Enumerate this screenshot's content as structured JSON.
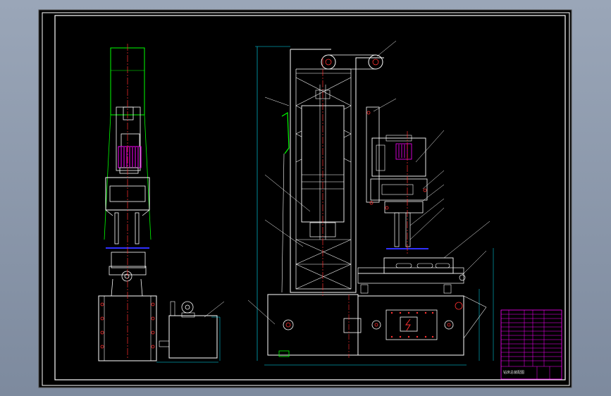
{
  "title_block": {
    "title": "钻床总装配图",
    "rows": [
      "",
      "",
      "",
      "",
      "",
      "",
      "",
      "",
      "",
      "",
      "",
      ""
    ]
  },
  "colors": {
    "background": "#000000",
    "frame": "#ffffff",
    "part_lines": "#ffffff",
    "center_lines": "#ff3030",
    "green_outline": "#00ff00",
    "magenta": "#ff00ff",
    "cyan_dims": "#00e5ff",
    "blue": "#3030ff",
    "yellow": "#ffff00"
  },
  "icons": [
    "electric-hazard-icon"
  ]
}
